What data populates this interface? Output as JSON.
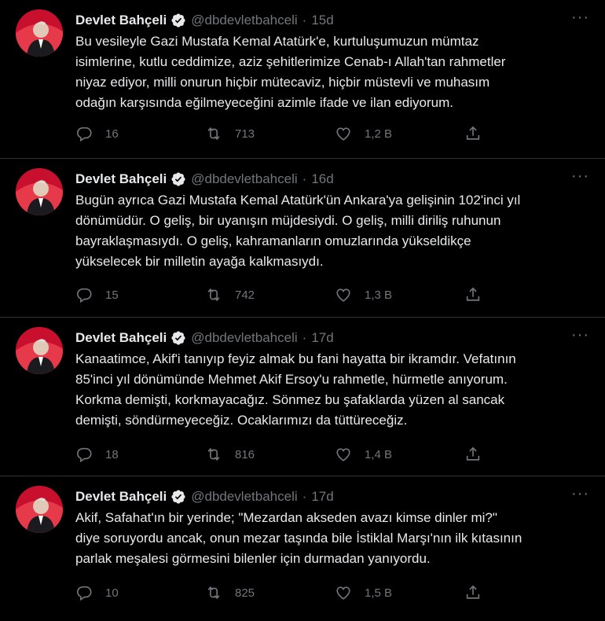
{
  "author": {
    "name": "Devlet Bahçeli",
    "handle": "@dbdevletbahceli",
    "separator": "·"
  },
  "colors": {
    "background": "#000000",
    "text": "#e7e9ea",
    "muted": "#71767b",
    "divider": "#2f3336",
    "avatar_red": "#c8102e"
  },
  "icons": {
    "reply": "reply-icon",
    "retweet": "retweet-icon",
    "like": "like-icon",
    "share": "share-icon",
    "verified": "verified-badge-icon",
    "more": "more-icon"
  },
  "tweets": [
    {
      "time": "15d",
      "lines": [
        "Bu vesileyle Gazi Mustafa Kemal Atatürk'e, kurtuluşumuzun mümtaz",
        "isimlerine, kutlu ceddimize, aziz şehitlerimize Cenab-ı Allah'tan rahmetler",
        "niyaz ediyor, milli onurun hiçbir mütecaviz, hiçbir müstevli ve muhasım",
        "odağın karşısında eğilmeyeceğini azimle ifade ve ilan ediyorum."
      ],
      "replies": "16",
      "retweets": "713",
      "likes": "1,2 B"
    },
    {
      "time": "16d",
      "lines": [
        "Bugün ayrıca Gazi Mustafa Kemal Atatürk'ün Ankara'ya gelişinin 102'inci yıl",
        "dönümüdür. O geliş, bir uyanışın müjdesiydi. O geliş, milli diriliş ruhunun",
        "bayraklaşmasıydı. O geliş, kahramanların omuzlarında yükseldikçe",
        "yükselecek bir milletin ayağa kalkmasıydı."
      ],
      "replies": "15",
      "retweets": "742",
      "likes": "1,3 B"
    },
    {
      "time": "17d",
      "lines": [
        "Kanaatimce, Akif'i tanıyıp feyiz almak bu fani hayatta bir ikramdır. Vefatının",
        "85'inci yıl dönümünde Mehmet Akif Ersoy'u rahmetle, hürmetle anıyorum.",
        "Korkma demişti, korkmayacağız. Sönmez bu şafaklarda yüzen al sancak",
        "demişti, söndürmeyeceğiz. Ocaklarımızı da tüttüreceğiz."
      ],
      "replies": "18",
      "retweets": "816",
      "likes": "1,4 B"
    },
    {
      "time": "17d",
      "lines": [
        "Akif, Safahat'ın bir yerinde; \"Mezardan akseden avazı kimse dinler mi?\"",
        "diye soruyordu ancak, onun mezar taşında bile İstiklal Marşı'nın ilk kıtasının",
        "parlak meşalesi görmesini bilenler için durmadan yanıyordu."
      ],
      "replies": "10",
      "retweets": "825",
      "likes": "1,5 B"
    }
  ]
}
